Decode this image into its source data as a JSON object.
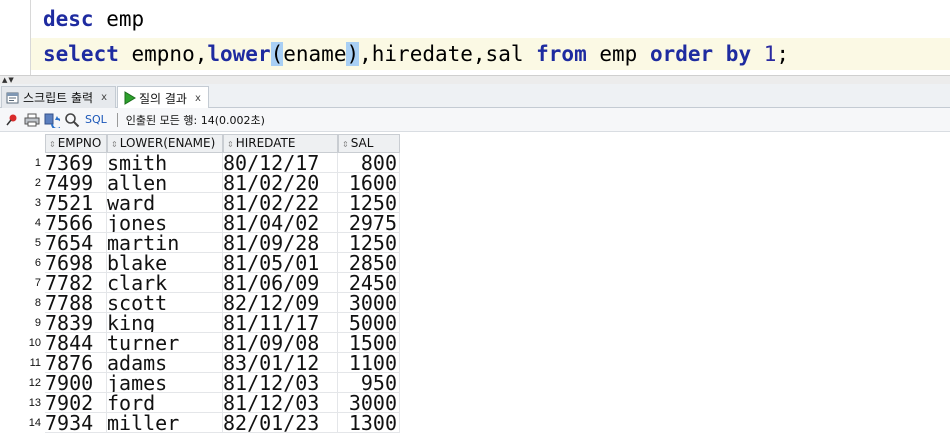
{
  "editor": {
    "line1": {
      "kw": "desc",
      "rest": " emp"
    },
    "line2": {
      "kw_select": "select",
      "t1": " empno,",
      "kw_lower": "lower",
      "paren_open": "(",
      "t2": "ename",
      "paren_close": ")",
      "t3": ",hiredate,sal ",
      "kw_from": "from",
      "t4": " emp ",
      "kw_order": "order by",
      "t5": " ",
      "num": "1",
      "t6": ";"
    }
  },
  "splitter": {
    "arrows": "▲▼"
  },
  "tabs": [
    {
      "label": "스크립트 출력",
      "close": "x",
      "icon": "script-output-icon"
    },
    {
      "label": "질의 결과",
      "close": "x",
      "icon": "run-icon"
    }
  ],
  "toolbar": {
    "sql_label": "SQL",
    "status": "인출된 모든 행: 14(0.002초)"
  },
  "grid": {
    "columns": [
      "EMPNO",
      "LOWER(ENAME)",
      "HIREDATE",
      "SAL"
    ],
    "rows": [
      [
        "1",
        "7369",
        "smith",
        "80/12/17",
        "800"
      ],
      [
        "2",
        "7499",
        "allen",
        "81/02/20",
        "1600"
      ],
      [
        "3",
        "7521",
        "ward",
        "81/02/22",
        "1250"
      ],
      [
        "4",
        "7566",
        "jones",
        "81/04/02",
        "2975"
      ],
      [
        "5",
        "7654",
        "martin",
        "81/09/28",
        "1250"
      ],
      [
        "6",
        "7698",
        "blake",
        "81/05/01",
        "2850"
      ],
      [
        "7",
        "7782",
        "clark",
        "81/06/09",
        "2450"
      ],
      [
        "8",
        "7788",
        "scott",
        "82/12/09",
        "3000"
      ],
      [
        "9",
        "7839",
        "king",
        "81/11/17",
        "5000"
      ],
      [
        "10",
        "7844",
        "turner",
        "81/09/08",
        "1500"
      ],
      [
        "11",
        "7876",
        "adams",
        "83/01/12",
        "1100"
      ],
      [
        "12",
        "7900",
        "james",
        "81/12/03",
        "950"
      ],
      [
        "13",
        "7902",
        "ford",
        "81/12/03",
        "3000"
      ],
      [
        "14",
        "7934",
        "miller",
        "82/01/23",
        "1300"
      ]
    ]
  },
  "colors": {
    "keyword": "#1e2ba0",
    "current_line": "#fbf9e4",
    "paren_match": "#a8cff4"
  }
}
